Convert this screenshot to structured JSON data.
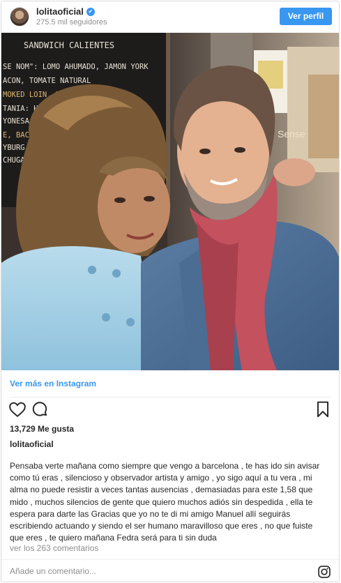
{
  "header": {
    "username": "lolitaoficial",
    "verified_badge": "✔",
    "followers": "275.5 mil seguidores",
    "view_profile_label": "Ver perfil"
  },
  "photo": {
    "sign_lines": [
      "SANDWICH CALIENTES",
      "SE NOM\": LOMO AHUMADO, JAMON YORK",
      "ACON, TOMATE NATURAL",
      "MOKED LOIN, HAM, BACO",
      "TANIA: HUEVO 2",
      "YONESA, SPI",
      "E, BACON",
      "YBURG",
      "CHUGA"
    ],
    "wall_text": "Sense"
  },
  "more_link": "Ver más en Instagram",
  "actions": {
    "like_icon": "heart-icon",
    "comment_icon": "comment-icon",
    "save_icon": "bookmark-icon"
  },
  "likes": "13,729 Me gusta",
  "caption_user": "lolitaoficial",
  "caption_lines": [
    "Pensaba verte mañana como siempre que vengo a barcelona , te has ido sin avisar",
    "como tú eras , silencioso y observador artista y amigo , yo sigo aquí a tu vera , mi",
    "alma no puede resistir a veces tantas ausencias , demasiadas para este 1,58 que",
    "mido , muchos silencios de gente que quiero muchos adiós sin despedida , ella te",
    "espera para darte las Gracias que yo no te di mi amigo Manuel allí seguirás",
    "escribiendo actuando y siendo el ser humano maravilloso que eres , no que fuiste",
    "que eres , te quiero mañana Fedra será para ti sin duda"
  ],
  "comments_link": "ver los 263 comentarios",
  "comment_input": {
    "placeholder": "Añade un comentario...",
    "value": ""
  },
  "colors": {
    "accent": "#3897f0",
    "text": "#262626",
    "muted": "#8e8e8e"
  }
}
